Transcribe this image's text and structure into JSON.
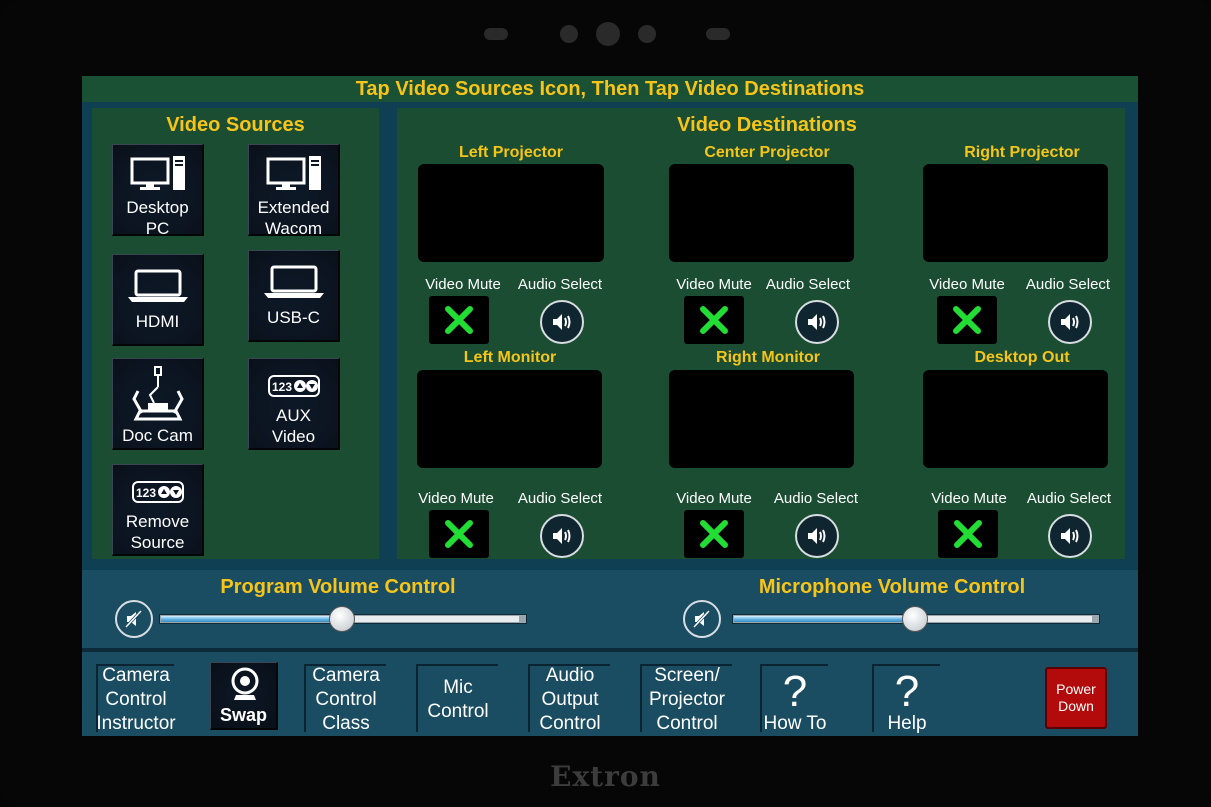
{
  "brand": "Extron",
  "instruction": "Tap Video Sources Icon, Then Tap Video Destinations",
  "sources": {
    "title": "Video Sources",
    "items": [
      {
        "line1": "Desktop",
        "line2": "PC",
        "icon": "desktop-pc-icon"
      },
      {
        "line1": "Extended",
        "line2": "Wacom",
        "icon": "desktop-pc-icon"
      },
      {
        "line1": "HDMI",
        "line2": "",
        "icon": "laptop-icon"
      },
      {
        "line1": "USB-C",
        "line2": "",
        "icon": "laptop-icon"
      },
      {
        "line1": "Doc Cam",
        "line2": "",
        "icon": "document-camera-icon"
      },
      {
        "line1": "AUX",
        "line2": "Video",
        "icon": "aux-input-icon"
      },
      {
        "line1": "Remove",
        "line2": "Source",
        "icon": "aux-input-icon"
      }
    ]
  },
  "destinations": {
    "title": "Video Destinations",
    "video_mute_label": "Video Mute",
    "audio_select_label": "Audio Select",
    "items": [
      {
        "name": "Left Projector"
      },
      {
        "name": "Center Projector"
      },
      {
        "name": "Right Projector"
      },
      {
        "name": "Left Monitor"
      },
      {
        "name": "Right Monitor"
      },
      {
        "name": "Desktop Out"
      }
    ]
  },
  "volume": {
    "program": {
      "title": "Program Volume Control",
      "level_percent": 50
    },
    "microphone": {
      "title": "Microphone Volume Control",
      "level_percent": 50
    }
  },
  "nav": {
    "camera_instructor": {
      "l1": "Camera",
      "l2": "Control",
      "l3": "Instructor"
    },
    "swap": "Swap",
    "camera_class": {
      "l1": "Camera",
      "l2": "Control",
      "l3": "Class"
    },
    "mic": {
      "l1": "Mic",
      "l2": "Control"
    },
    "audio_output": {
      "l1": "Audio",
      "l2": "Output",
      "l3": "Control"
    },
    "screen_projector": {
      "l1": "Screen/",
      "l2": "Projector",
      "l3": "Control"
    },
    "howto": {
      "glyph": "?",
      "label": "How To"
    },
    "help": {
      "glyph": "?",
      "label": "Help"
    },
    "power": {
      "l1": "Power",
      "l2": "Down"
    }
  },
  "colors": {
    "accent_yellow": "#f7c418",
    "panel_green": "#1a4d31",
    "band_blue": "#1b4d62",
    "power_red": "#b30b0b",
    "mute_green": "#22dd33"
  }
}
